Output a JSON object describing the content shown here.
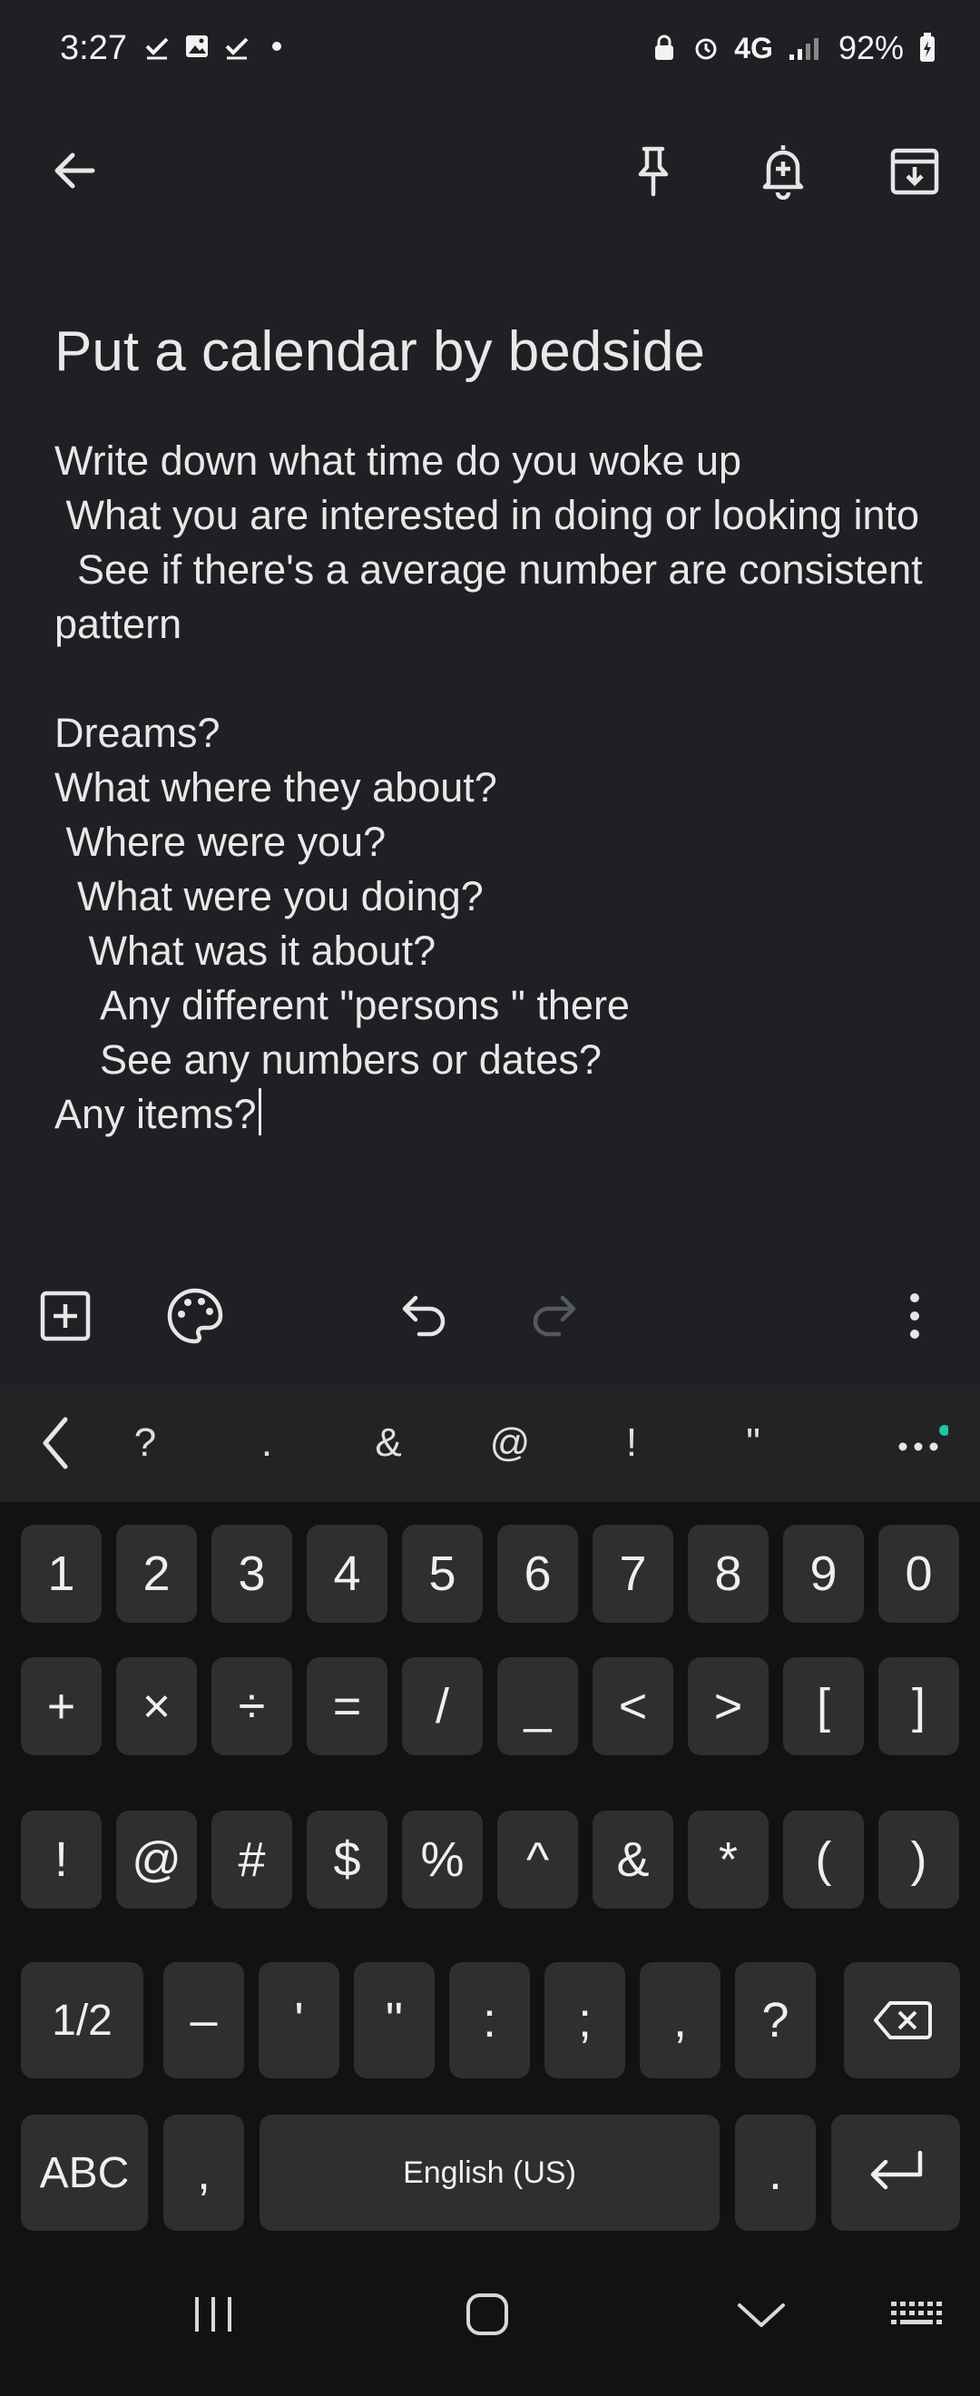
{
  "status_bar": {
    "time": "3:27",
    "network": "4G",
    "battery": "92%"
  },
  "note": {
    "title": "Put a calendar by bedside",
    "body_lines": [
      "Write down what time do you woke up",
      " What you are interested in doing or looking into",
      "  See if there's a average number are consistent pattern",
      "",
      "Dreams?",
      "What where they about?",
      " Where were you?",
      "  What were you doing?",
      "   What was it about?",
      "    Any different \"persons \" there",
      "    See any numbers or dates?",
      "Any items?"
    ]
  },
  "suggestion_strip": {
    "items": [
      "?",
      ".",
      "&",
      "@",
      "!",
      "\""
    ]
  },
  "keyboard": {
    "row1": [
      "1",
      "2",
      "3",
      "4",
      "5",
      "6",
      "7",
      "8",
      "9",
      "0"
    ],
    "row2": [
      "+",
      "×",
      "÷",
      "=",
      "/",
      "_",
      "<",
      ">",
      "[",
      "]"
    ],
    "row3": [
      "!",
      "@",
      "#",
      "$",
      "%",
      "^",
      "&",
      "*",
      "(",
      ")"
    ],
    "row4": [
      "1/2",
      "–",
      "'",
      "\"",
      ":",
      ";",
      ",",
      "?"
    ],
    "row5_left": "ABC",
    "row5_comma": ",",
    "space_label": "English (US)",
    "row5_period": "."
  },
  "colors": {
    "background": "#1e2023",
    "keyboard_bg": "#121212",
    "key_bg": "#2f2f31",
    "accent_dot": "#1fc4a8"
  },
  "icons": {
    "back": "arrow-left-icon",
    "pin": "pin-icon",
    "reminder": "bell-plus-icon",
    "archive": "archive-icon",
    "add": "add-box-icon",
    "palette": "palette-icon",
    "undo": "undo-icon",
    "redo": "redo-icon",
    "more": "more-vert-icon"
  }
}
